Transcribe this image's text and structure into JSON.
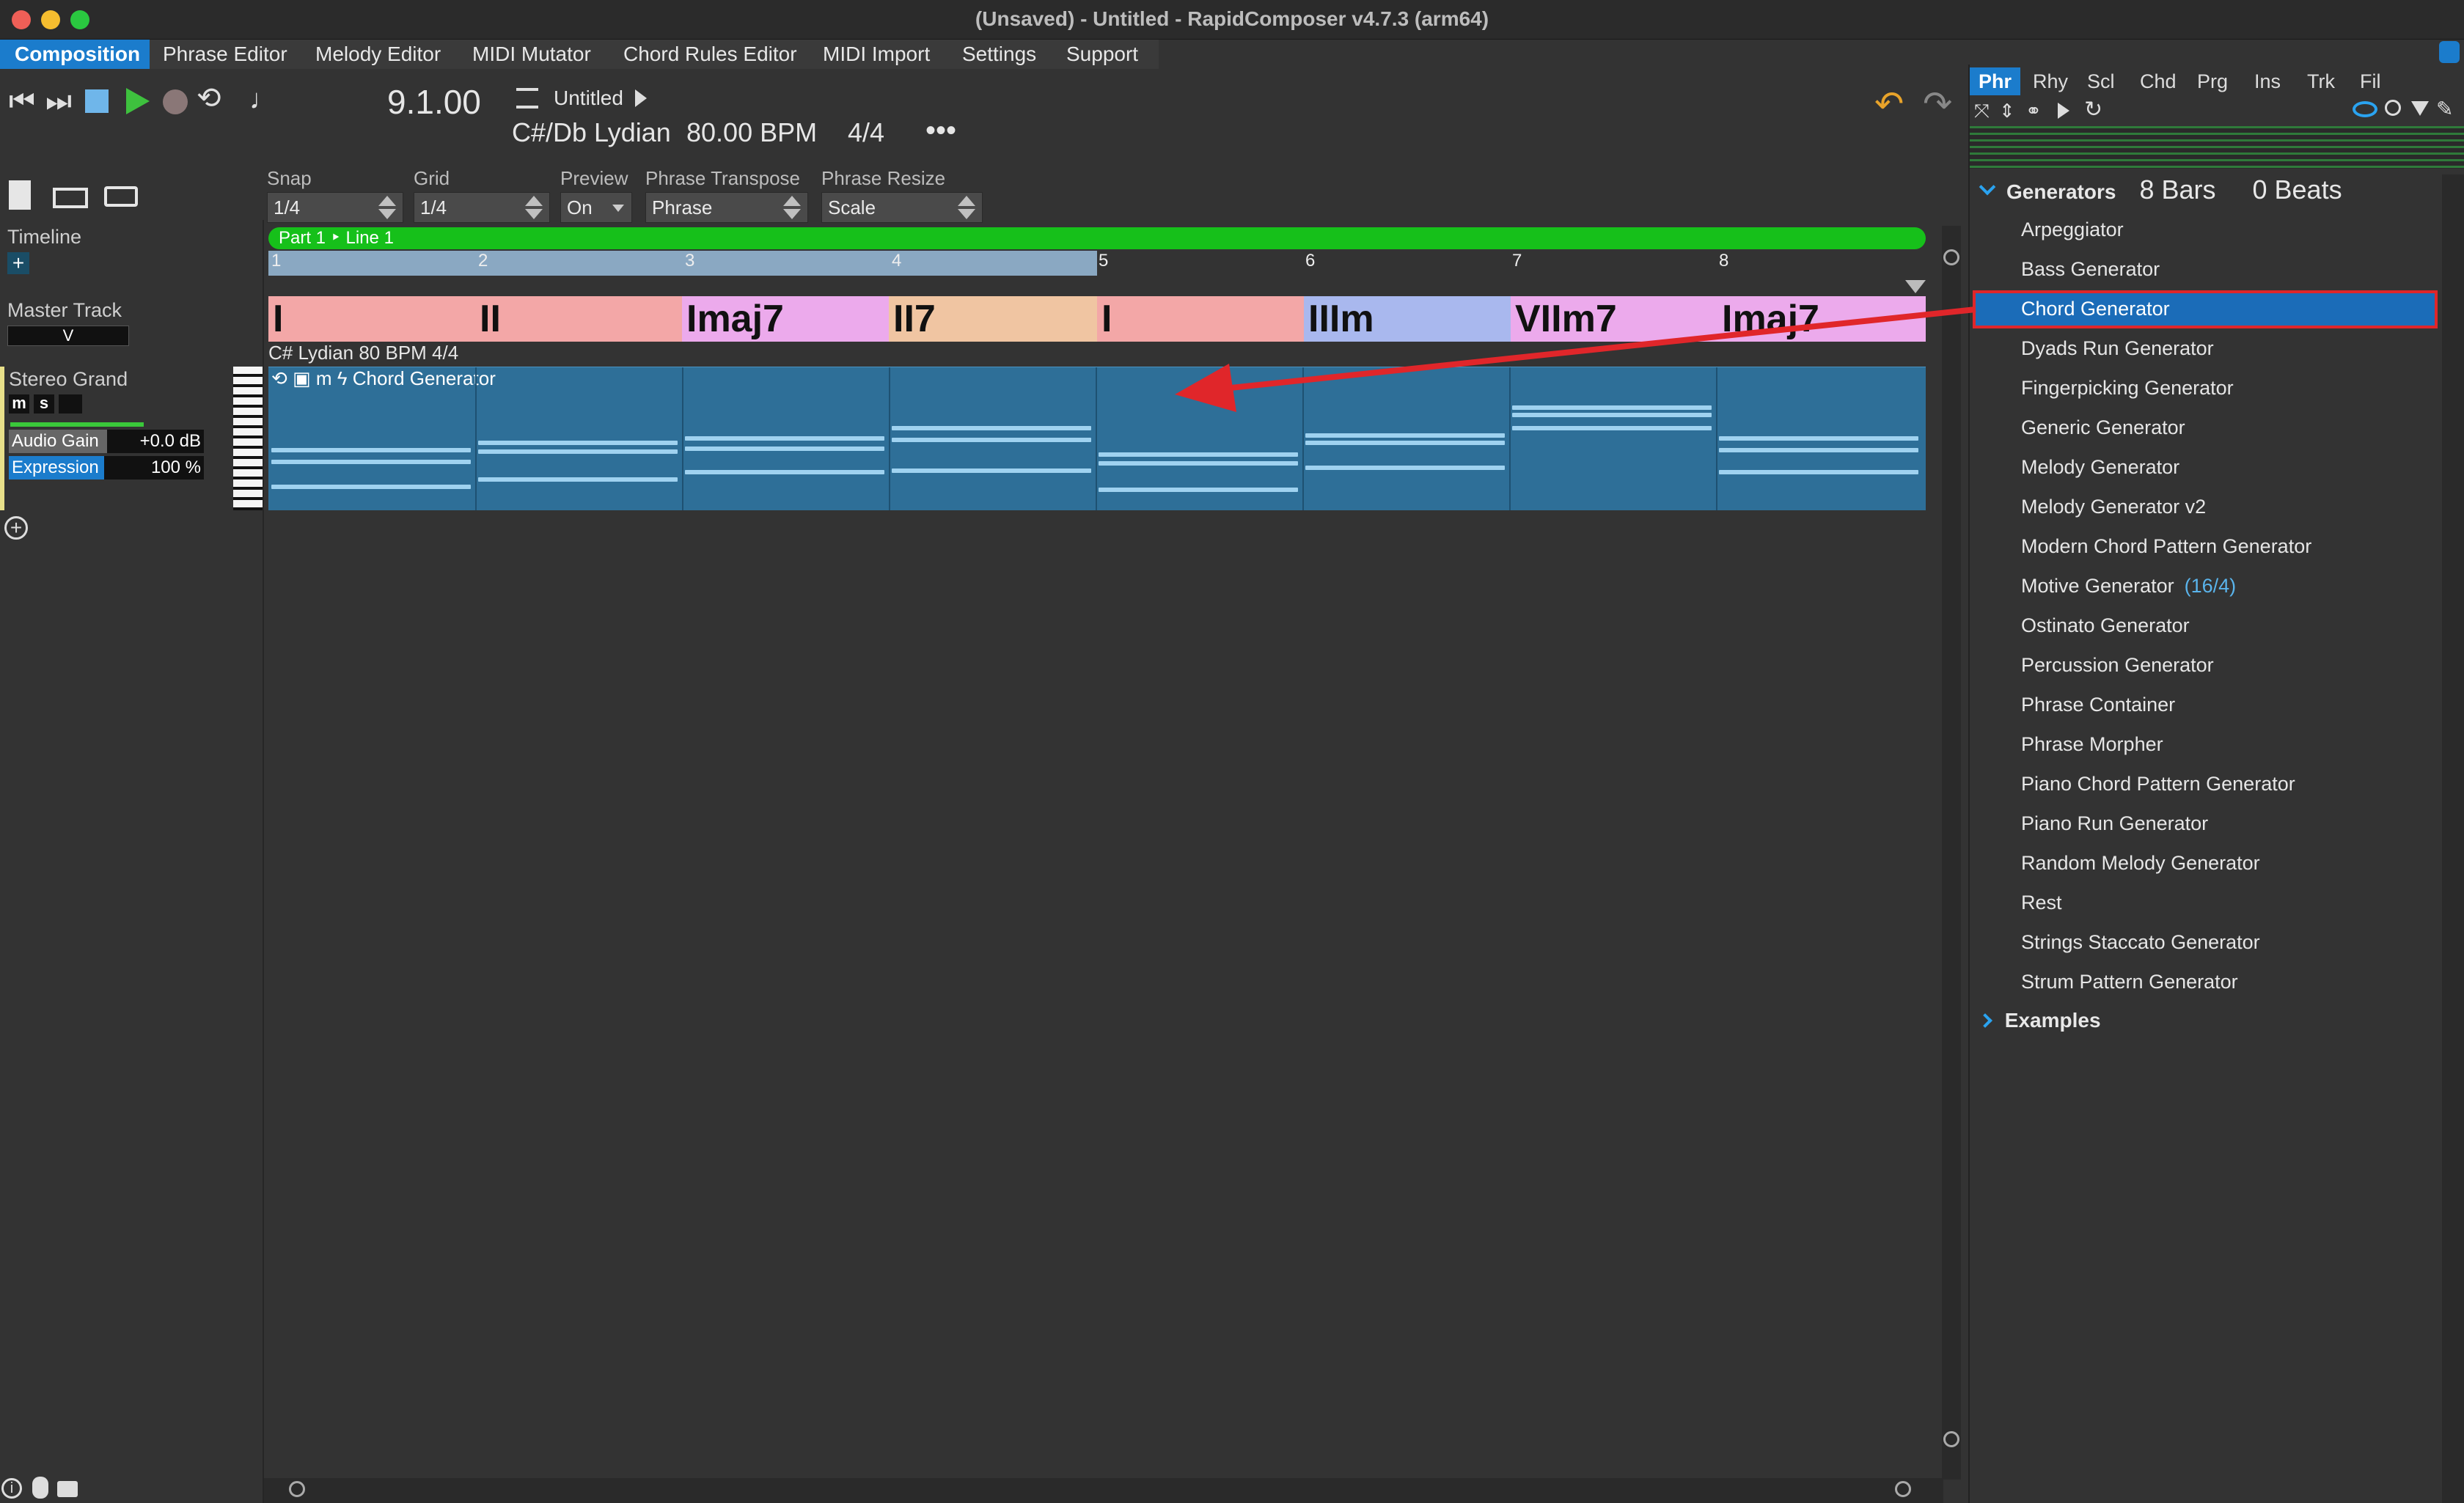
{
  "window": {
    "title": "(Unsaved) - Untitled - RapidComposer v4.7.3 (arm64)"
  },
  "menu": [
    "Composition",
    "Phrase Editor",
    "Melody Editor",
    "MIDI Mutator",
    "Chord Rules Editor",
    "MIDI Import",
    "Settings",
    "Support"
  ],
  "transport": {
    "position": "9.1.00",
    "song_title": "Untitled",
    "key": "C#/Db Lydian",
    "tempo": "80.00 BPM",
    "time_sig": "4/4",
    "more": "•••"
  },
  "controls": {
    "snap_label": "Snap",
    "snap_value": "1/4",
    "grid_label": "Grid",
    "grid_value": "1/4",
    "preview_label": "Preview",
    "preview_value": "On",
    "transpose_label": "Phrase Transpose",
    "transpose_value": "Phrase",
    "resize_label": "Phrase Resize",
    "resize_value": "Scale"
  },
  "tracks": {
    "timeline": "Timeline",
    "master": "Master Track",
    "master_buttons": "V",
    "instrument": "Stereo Grand",
    "mute": "m",
    "solo": "s",
    "audio_gain_label": "Audio Gain",
    "audio_gain_value": "+0.0 dB",
    "expression_label": "Expression",
    "expression_value": "100 %"
  },
  "arrangement": {
    "part_label": "Part 1 ‣ Line 1",
    "ruler": [
      "1",
      "2",
      "3",
      "4",
      "5",
      "6",
      "7",
      "8"
    ],
    "chords": [
      {
        "label": "I",
        "color": "#f3a7a7"
      },
      {
        "label": "II",
        "color": "#f3a7a7"
      },
      {
        "label": "Imaj7",
        "color": "#ecaaec"
      },
      {
        "label": "II7",
        "color": "#f0c5a2"
      },
      {
        "label": "I",
        "color": "#f3a7a7"
      },
      {
        "label": "IIIm",
        "color": "#a9b8ee"
      },
      {
        "label": "VIIm7",
        "color": "#ecaaec"
      },
      {
        "label": "Imaj7",
        "color": "#ecaaec"
      }
    ],
    "master_info": "C# Lydian 80 BPM 4/4",
    "phrase_name": "Chord Generator",
    "phrase_icons": "m"
  },
  "right_tabs": [
    "Phr",
    "Rhy",
    "Scl",
    "Chd",
    "Prg",
    "Ins",
    "Trk",
    "Fil"
  ],
  "generators": {
    "header": "Generators",
    "bars": "8 Bars",
    "beats": "0 Beats",
    "items": [
      "Arpeggiator",
      "Bass Generator",
      "Chord Generator",
      "Dyads Run Generator",
      "Fingerpicking Generator",
      "Generic Generator",
      "Melody Generator",
      "Melody Generator v2",
      "Modern Chord Pattern Generator",
      "Motive Generator",
      "Ostinato Generator",
      "Percussion Generator",
      "Phrase Container",
      "Phrase Morpher",
      "Piano Chord Pattern Generator",
      "Piano Run Generator",
      "Random Melody Generator",
      "Rest",
      "Strings Staccato Generator",
      "Strum Pattern Generator"
    ],
    "motive_suffix": "(16/4)",
    "selected_index": 2,
    "examples": "Examples"
  },
  "colors": {
    "accent": "#1b7ccc",
    "part_green": "#16c01a",
    "annotation_red": "#e0262a"
  }
}
